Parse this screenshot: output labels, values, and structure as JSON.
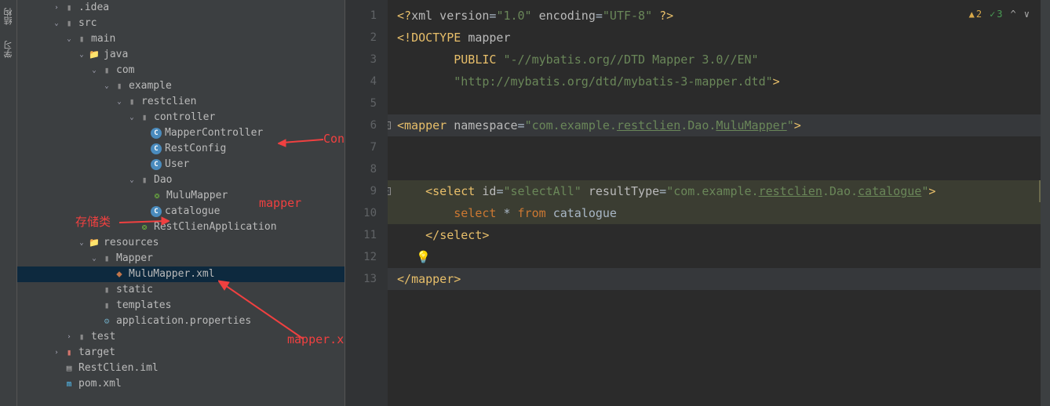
{
  "sidebar_tabs": {
    "structure": "结构",
    "learn": "学习"
  },
  "tree": [
    {
      "indent": 40,
      "chev": "right",
      "icon": "folder-dark",
      "label": ".idea"
    },
    {
      "indent": 40,
      "chev": "down",
      "icon": "folder-dark",
      "label": "src"
    },
    {
      "indent": 56,
      "chev": "down",
      "icon": "folder-dark",
      "label": "main"
    },
    {
      "indent": 72,
      "chev": "down",
      "icon": "folder",
      "label": "java"
    },
    {
      "indent": 88,
      "chev": "down",
      "icon": "folder-dark",
      "label": "com"
    },
    {
      "indent": 104,
      "chev": "down",
      "icon": "folder-dark",
      "label": "example"
    },
    {
      "indent": 120,
      "chev": "down",
      "icon": "folder-dark",
      "label": "restclien"
    },
    {
      "indent": 136,
      "chev": "down",
      "icon": "folder-dark",
      "label": "controller"
    },
    {
      "indent": 152,
      "chev": "",
      "icon": "class-c",
      "label": "MapperController"
    },
    {
      "indent": 152,
      "chev": "",
      "icon": "class-c",
      "label": "RestConfig"
    },
    {
      "indent": 152,
      "chev": "",
      "icon": "class-c",
      "label": "User"
    },
    {
      "indent": 136,
      "chev": "down",
      "icon": "folder-dark",
      "label": "Dao"
    },
    {
      "indent": 152,
      "chev": "",
      "icon": "spring",
      "label": "MuluMapper"
    },
    {
      "indent": 152,
      "chev": "",
      "icon": "class-c",
      "label": "catalogue"
    },
    {
      "indent": 136,
      "chev": "",
      "icon": "spring",
      "label": "RestClienApplication"
    },
    {
      "indent": 72,
      "chev": "down",
      "icon": "folder",
      "label": "resources"
    },
    {
      "indent": 88,
      "chev": "down",
      "icon": "folder-dark",
      "label": "Mapper"
    },
    {
      "indent": 104,
      "chev": "",
      "icon": "xml",
      "label": "MuluMapper.xml",
      "selected": true
    },
    {
      "indent": 88,
      "chev": "",
      "icon": "folder-dark",
      "label": "static"
    },
    {
      "indent": 88,
      "chev": "",
      "icon": "folder-dark",
      "label": "templates"
    },
    {
      "indent": 88,
      "chev": "",
      "icon": "config",
      "label": "application.properties"
    },
    {
      "indent": 56,
      "chev": "right",
      "icon": "folder-dark",
      "label": "test"
    },
    {
      "indent": 40,
      "chev": "right",
      "icon": "folder-ex",
      "label": "target"
    },
    {
      "indent": 40,
      "chev": "",
      "icon": "iml",
      "label": "RestClien.iml"
    },
    {
      "indent": 40,
      "chev": "",
      "icon": "maven",
      "label": "pom.xml"
    }
  ],
  "annotations": {
    "controller": "Controller层",
    "mapper": "mapper",
    "storage": "存储类",
    "mapperxml": "mapper.xml"
  },
  "editor": {
    "line_numbers": [
      "1",
      "2",
      "3",
      "4",
      "5",
      "6",
      "7",
      "8",
      "9",
      "10",
      "11",
      "12",
      "13"
    ],
    "code": {
      "l1": {
        "pre": "<?",
        "tag": "xml version",
        "eq": "=",
        "v1": "\"1.0\"",
        "sp": " ",
        "attr": "encoding",
        "v2": "\"UTF-8\"",
        "end": " ?>"
      },
      "l2": {
        "open": "<!",
        "doct": "DOCTYPE ",
        "root": "mapper"
      },
      "l3": {
        "pad": "        ",
        "kw": "PUBLIC ",
        "v": "\"-//mybatis.org//DTD Mapper 3.0//EN\""
      },
      "l4": {
        "pad": "        ",
        "v": "\"http://mybatis.org/dtd/mybatis-3-mapper.dtd\"",
        "end": ">"
      },
      "l6": {
        "open": "<",
        "tag": "mapper ",
        "attr": "namespace",
        "eq": "=",
        "v_pre": "\"com.example.",
        "v_u1": "restclien",
        "v_mid": ".Dao.",
        "v_u2": "MuluMapper",
        "v_end": "\"",
        "close": ">"
      },
      "l9": {
        "pad": "    ",
        "open": "<",
        "tag": "select ",
        "a1": "id",
        "eq": "=",
        "v1": "\"selectAll\"",
        "sp": " ",
        "a2": "resultType",
        "v2_pre": "\"com.example.",
        "v2_u": "restclien",
        "v2_mid": ".Dao.",
        "v2_u2": "catalogue",
        "v2_end": "\"",
        "close": ">"
      },
      "l10": {
        "pad": "        ",
        "kw1": "select",
        "sp1": " * ",
        "kw2": "from",
        "sp2": " ",
        "tbl": "catalogue"
      },
      "l11": {
        "pad": "    ",
        "open": "</",
        "tag": "select",
        "close": ">"
      },
      "l13": {
        "open": "</",
        "tag": "mapper",
        "close": ">"
      }
    },
    "status": {
      "warn": "2",
      "ok": "3",
      "caret": "^",
      "down": "∨"
    }
  }
}
